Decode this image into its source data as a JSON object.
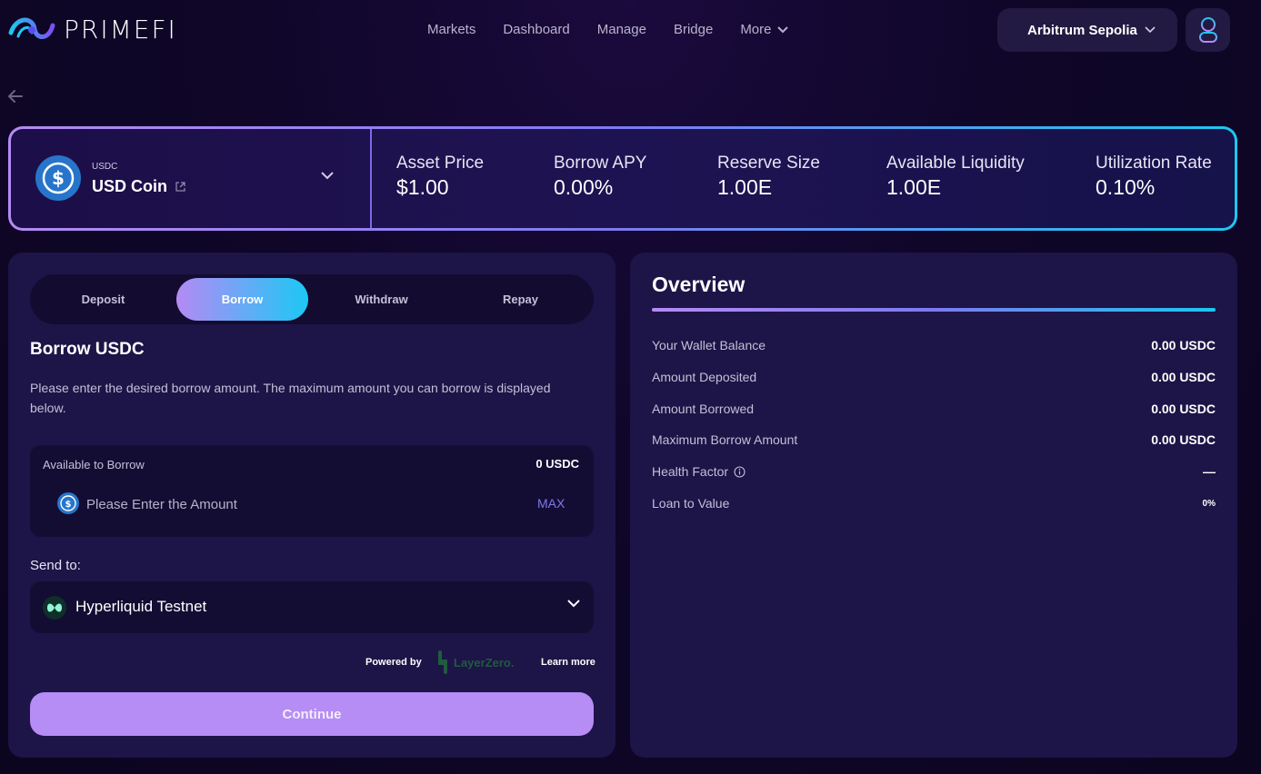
{
  "brand": {
    "name": "PRIMEFI"
  },
  "nav": {
    "items": [
      "Markets",
      "Dashboard",
      "Manage",
      "Bridge"
    ],
    "more_label": "More"
  },
  "header": {
    "network": "Arbitrum Sepolia"
  },
  "asset": {
    "symbol": "USDC",
    "name": "USD Coin",
    "icon": "usdc-icon"
  },
  "stats": [
    {
      "label": "Asset Price",
      "value": "$1.00"
    },
    {
      "label": "Borrow APY",
      "value": "0.00%"
    },
    {
      "label": "Reserve Size",
      "value": "1.00E"
    },
    {
      "label": "Available Liquidity",
      "value": "1.00E"
    },
    {
      "label": "Utilization Rate",
      "value": "0.10%"
    }
  ],
  "tabs": [
    {
      "label": "Deposit",
      "active": false
    },
    {
      "label": "Borrow",
      "active": true
    },
    {
      "label": "Withdraw",
      "active": false
    },
    {
      "label": "Repay",
      "active": false
    }
  ],
  "borrow_form": {
    "title": "Borrow USDC",
    "description": "Please enter the desired borrow amount. The maximum amount you can borrow is displayed below.",
    "available_label": "Available to Borrow",
    "available_value": "0 USDC",
    "amount_placeholder": "Please Enter the Amount",
    "amount_value": "",
    "max_label": "MAX",
    "send_to_label": "Send to:",
    "destination_chain": "Hyperliquid Testnet",
    "powered_by_label": "Powered by",
    "layerzero_label": "LayerZero.",
    "learn_more_label": "Learn more",
    "continue_label": "Continue"
  },
  "overview": {
    "title": "Overview",
    "rows": [
      {
        "label": "Your Wallet Balance",
        "value": "0.00 USDC"
      },
      {
        "label": "Amount Deposited",
        "value": "0.00 USDC"
      },
      {
        "label": "Amount Borrowed",
        "value": "0.00 USDC"
      },
      {
        "label": "Maximum Borrow Amount",
        "value": "0.00 USDC"
      },
      {
        "label": "Health Factor",
        "value": "—"
      },
      {
        "label": "Loan to Value",
        "value": "0%"
      }
    ]
  },
  "colors": {
    "accent_purple": "#b58af5",
    "accent_cyan": "#1dc7f0",
    "card_bg": "#1d1447",
    "continue_bg": "#b68cf5"
  }
}
